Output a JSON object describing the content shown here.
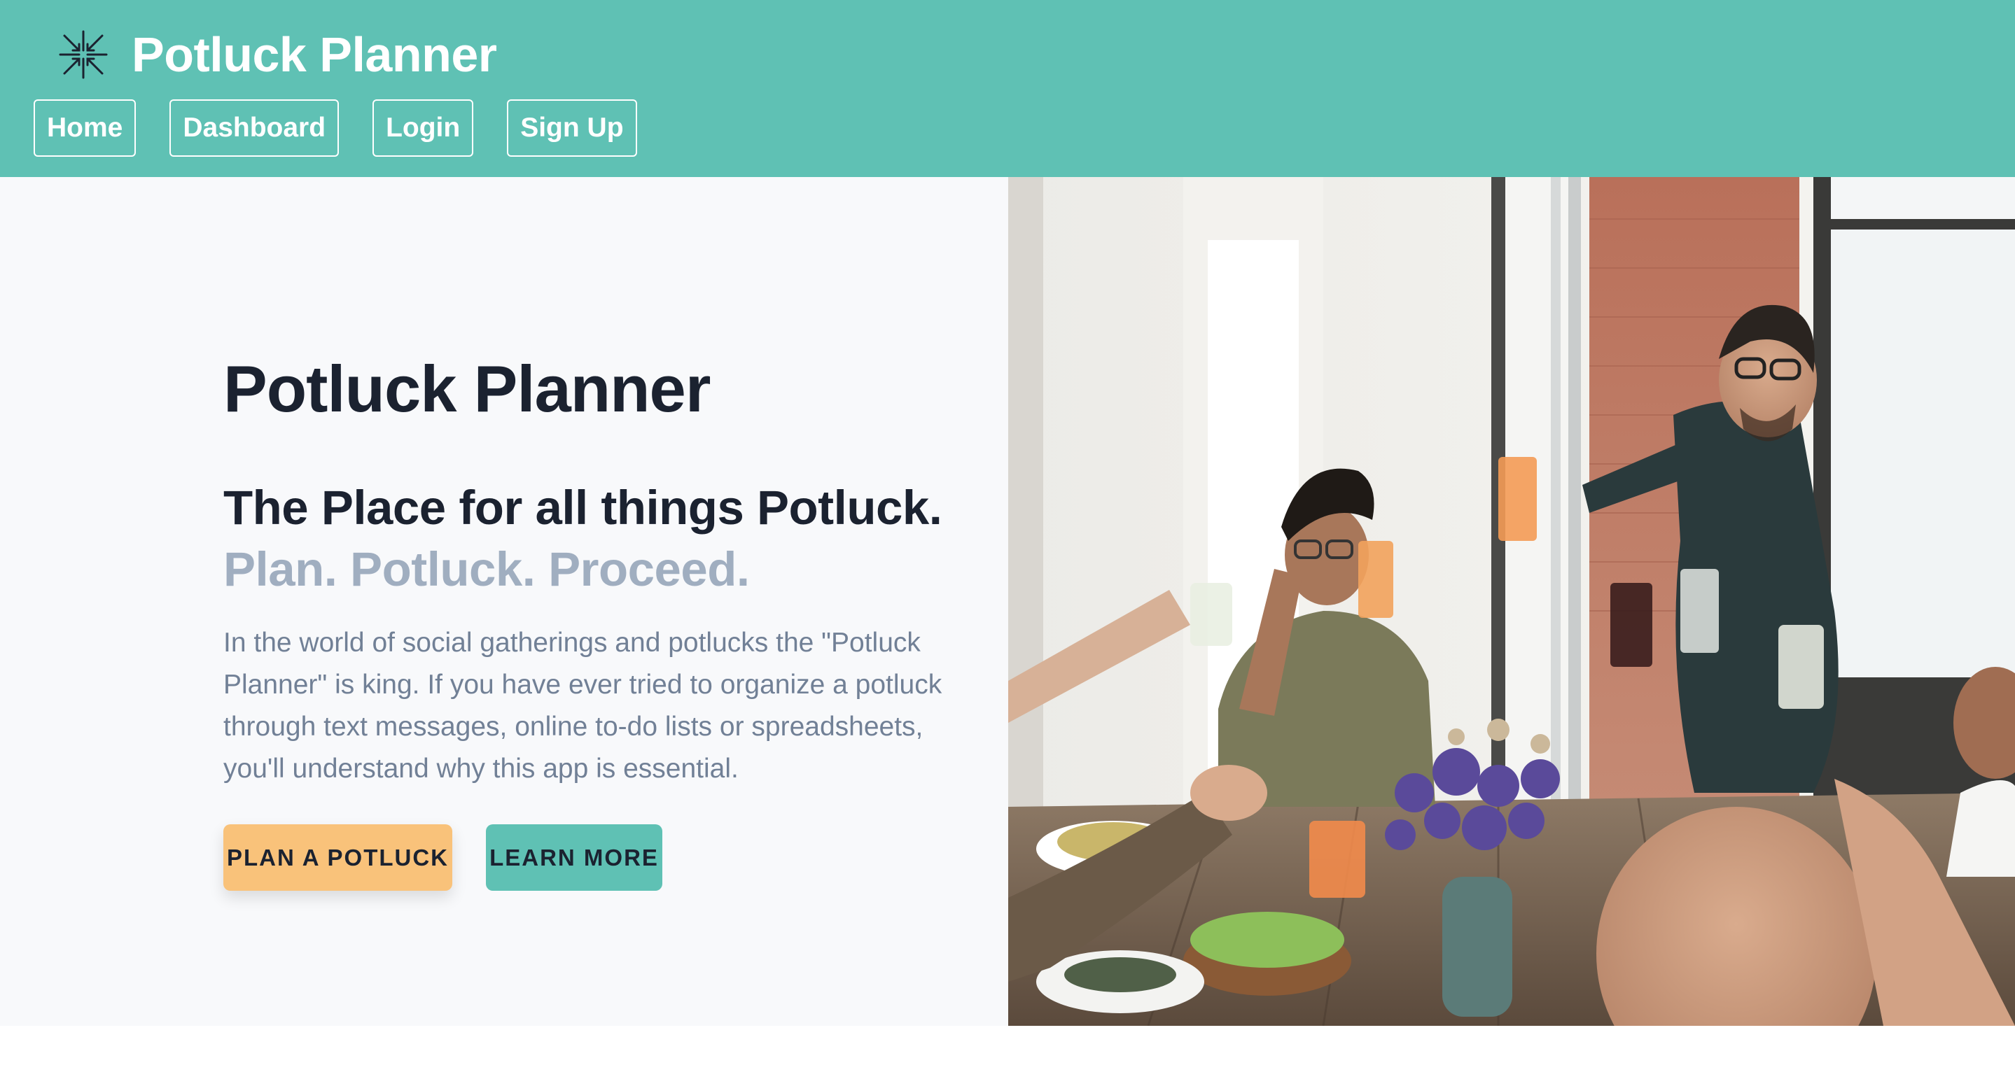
{
  "brand": {
    "title": "Potluck Planner",
    "logo_icon": "arrows-converge-icon"
  },
  "nav": {
    "items": [
      {
        "label": "Home"
      },
      {
        "label": "Dashboard"
      },
      {
        "label": "Login"
      },
      {
        "label": "Sign Up"
      }
    ]
  },
  "hero": {
    "title": "Potluck Planner",
    "subtitle": "The Place for all things Potluck.",
    "tagline": "Plan. Potluck. Proceed.",
    "description": "In the world of social gatherings and potlucks the \"Potluck Planner\" is king. If you have ever tried to organize a potluck through text messages, online to-do lists or spreadsheets, you'll understand why this app is essential.",
    "primary_cta": "PLAN A POTLUCK",
    "secondary_cta": "LEARN MORE",
    "image_subject": "friends-toasting-at-dinner-table-photo"
  },
  "colors": {
    "header_bg": "#5fc1b4",
    "page_bg": "#f8f9fb",
    "heading": "#1b2230",
    "tagline": "#a0aec0",
    "body_text": "#718096",
    "primary_cta_bg": "#f9c27a",
    "secondary_cta_bg": "#5fc1b4"
  }
}
